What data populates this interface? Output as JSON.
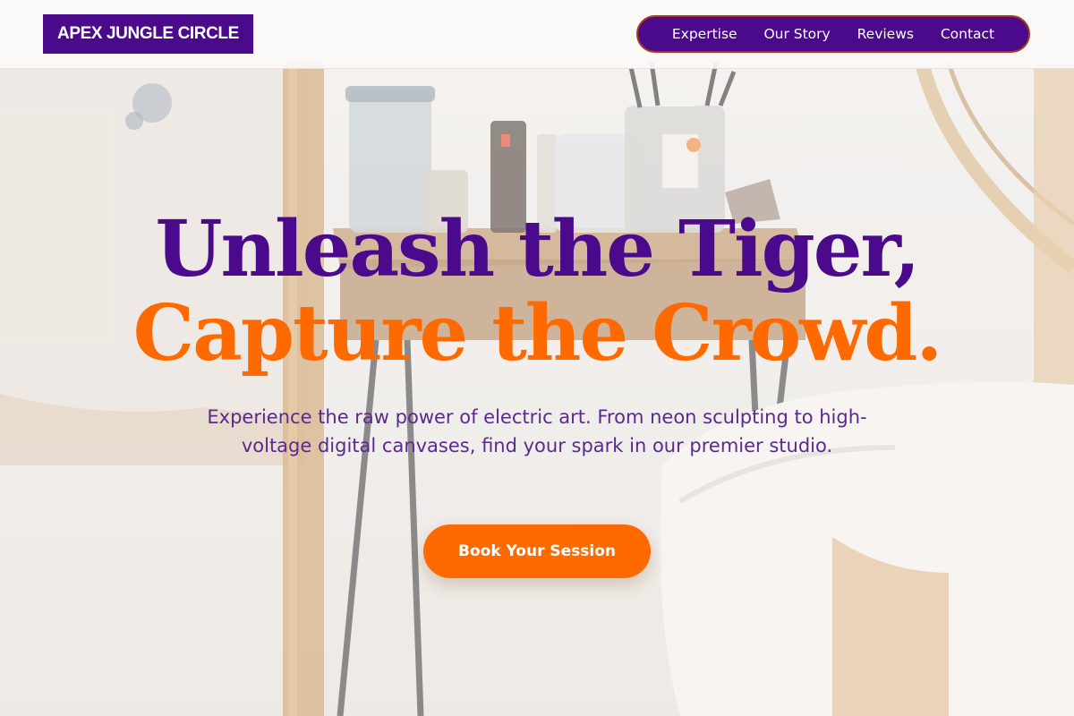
{
  "brand": {
    "name": "APEX JUNGLE CIRCLE"
  },
  "nav": {
    "items": [
      {
        "label": "Expertise"
      },
      {
        "label": "Our Story"
      },
      {
        "label": "Reviews"
      },
      {
        "label": "Contact"
      }
    ]
  },
  "hero": {
    "heading_line_1": "Unleash the Tiger,",
    "heading_line_2": "Capture the Crowd.",
    "subtext": "Experience the raw power of electric art. From neon sculpting to high-voltage digital canvases, find your spark in our premier studio.",
    "cta_label": "Book Your Session"
  },
  "colors": {
    "primary_purple": "#4b0a8c",
    "accent_orange": "#ff6a00",
    "text_purple": "#5a2a8c"
  }
}
